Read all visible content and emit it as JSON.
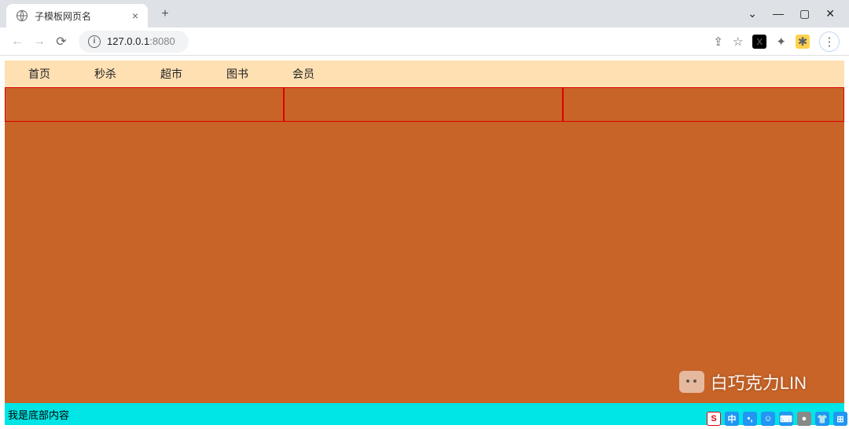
{
  "browser": {
    "tab_title": "子模板网页名",
    "url_host": "127.0.0.1",
    "url_port": ":8080"
  },
  "nav": {
    "items": [
      "首页",
      "秒杀",
      "超市",
      "图书",
      "会员"
    ]
  },
  "footer": {
    "text": "我是底部内容"
  },
  "watermark": {
    "text": "白巧克力LIN"
  },
  "ime": {
    "label": "中"
  }
}
